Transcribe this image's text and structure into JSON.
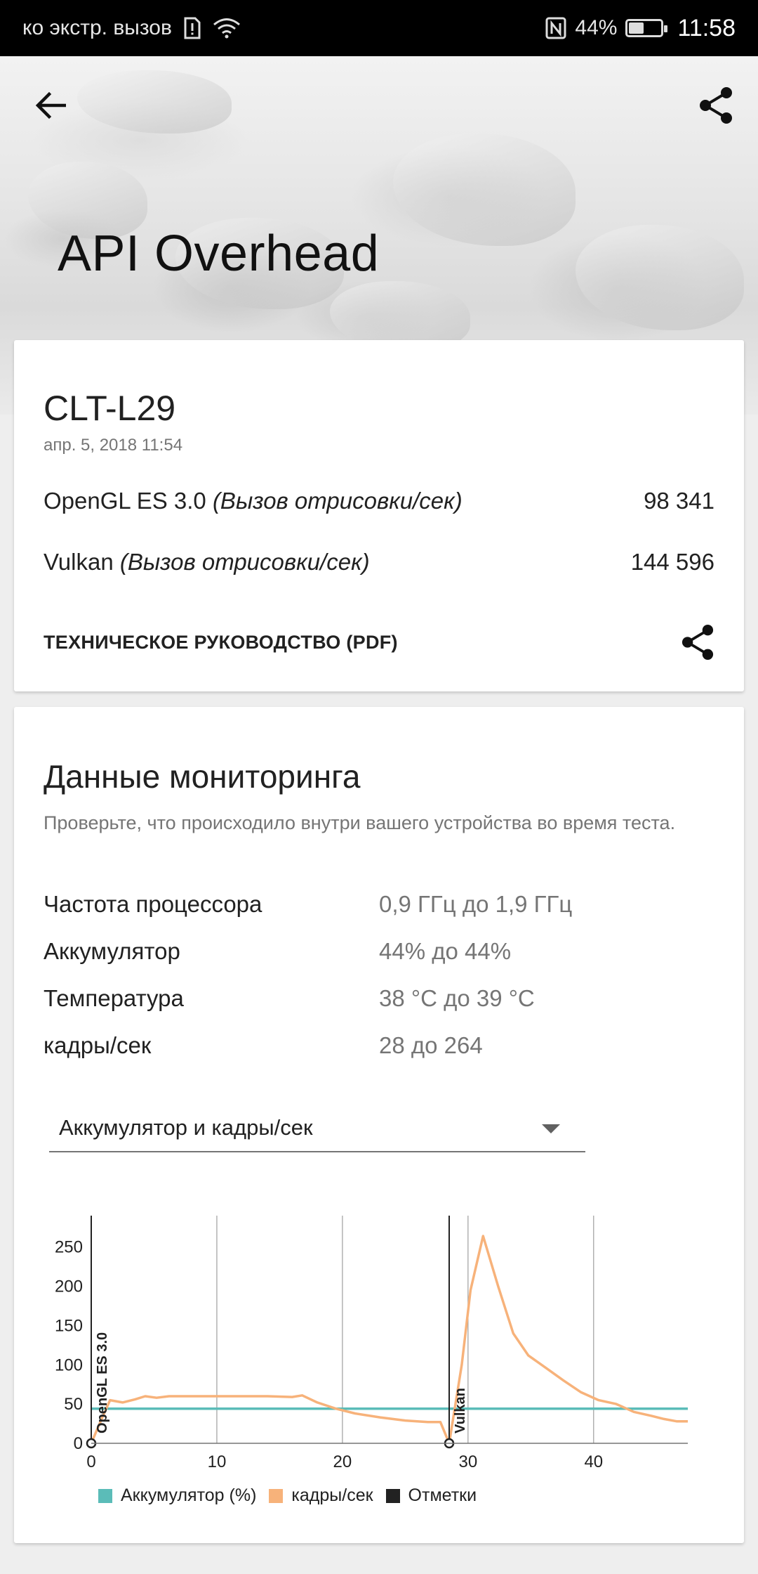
{
  "status_bar": {
    "carrier_text": "ко экстр. вызов",
    "battery": "44%",
    "battery_fraction": 0.44,
    "time": "11:58"
  },
  "header": {
    "title": "API Overhead"
  },
  "result_card": {
    "device": "CLT-L29",
    "date": "апр. 5, 2018 11:54",
    "scores": [
      {
        "api": "OpenGL ES 3.0",
        "unit": "(Вызов отрисовки/сек)",
        "value": "98 341"
      },
      {
        "api": "Vulkan",
        "unit": "(Вызов отрисовки/сек)",
        "value": "144 596"
      }
    ],
    "pdf_link": "ТЕХНИЧЕСКОЕ РУКОВОДСТВО (PDF)"
  },
  "monitoring": {
    "title": "Данные мониторинга",
    "description": "Проверьте, что происходило внутри вашего устройства во время теста.",
    "stats": [
      {
        "label": "Частота процессора",
        "value": "0,9 ГГц до 1,9 ГГц"
      },
      {
        "label": "Аккумулятор",
        "value": "44% до 44%"
      },
      {
        "label": "Температура",
        "value": "38 °C до 39 °C"
      },
      {
        "label": "кадры/сек",
        "value": "28 до 264"
      }
    ],
    "dropdown_selected": "Аккумулятор и кадры/сек"
  },
  "colors": {
    "battery_series": "#5bbcb8",
    "fps_series": "#f7b27a",
    "markers": "#222222"
  },
  "icons": [
    "arrow-back-icon",
    "share-icon",
    "chevron-down-icon",
    "nfc-icon",
    "wifi-icon",
    "sim-alert-icon",
    "battery-icon"
  ],
  "chart_data": {
    "type": "line",
    "xlim": [
      0,
      47.5
    ],
    "ylim": [
      0,
      290
    ],
    "x_ticks": [
      0,
      10,
      20,
      30,
      40
    ],
    "y_ticks": [
      0,
      50,
      100,
      150,
      200,
      250
    ],
    "grid": "vertical",
    "legend_position": "bottom",
    "markers": [
      {
        "label": "OpenGL ES 3.0",
        "x": 0
      },
      {
        "label": "Vulkan",
        "x": 28.5
      }
    ],
    "series": [
      {
        "name": "Аккумулятор (%)",
        "x": [
          0,
          47.5
        ],
        "y": [
          44,
          44
        ]
      },
      {
        "name": "кадры/сек",
        "x": [
          0,
          0.8,
          1.5,
          2.5,
          3.5,
          4.3,
          5.2,
          6.2,
          8,
          10,
          12,
          14,
          16,
          16.8,
          18,
          19.5,
          21,
          23,
          25,
          26.8,
          27.8,
          28.5,
          29.5,
          30.2,
          31.2,
          32.4,
          33.6,
          34.8,
          36.2,
          37.6,
          39,
          40.4,
          41.8,
          43.2,
          44.6,
          45.6,
          46.6,
          47.5
        ],
        "y": [
          0,
          30,
          55,
          52,
          56,
          60,
          58,
          60,
          60,
          60,
          60,
          60,
          59,
          61,
          52,
          44,
          38,
          33,
          29,
          27,
          27,
          0,
          100,
          195,
          264,
          200,
          140,
          112,
          96,
          80,
          65,
          55,
          50,
          40,
          35,
          31,
          28,
          28
        ]
      }
    ]
  }
}
